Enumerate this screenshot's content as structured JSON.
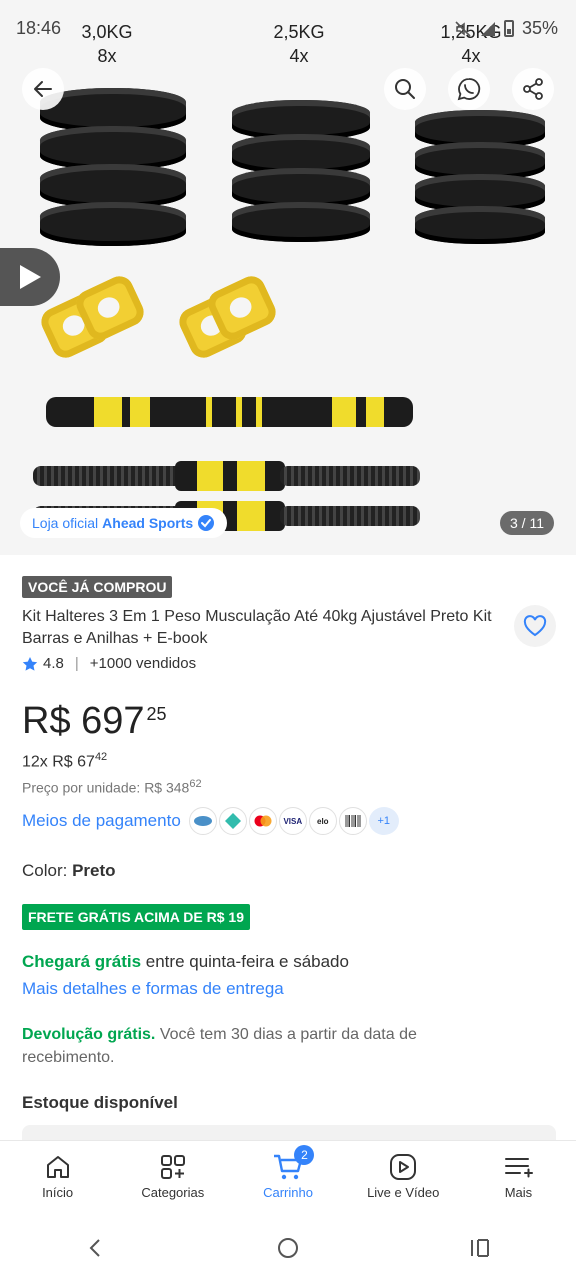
{
  "status_bar": {
    "time": "18:46",
    "battery": "35%"
  },
  "gallery": {
    "weights": [
      {
        "kg": "3,0KG",
        "qty": "8x"
      },
      {
        "kg": "2,5KG",
        "qty": "4x"
      },
      {
        "kg": "1,25KG",
        "qty": "4x"
      }
    ],
    "store_prefix": "Loja oficial",
    "store_name": "Ahead Sports",
    "counter": "3 / 11"
  },
  "product": {
    "badge": "VOCÊ JÁ COMPROU",
    "title": "Kit Halteres 3 Em 1 Peso Musculação Até 40kg Ajustável Preto Kit Barras e Anilhas + E-book",
    "rating": "4.8",
    "sold": "+1000 vendidos",
    "price_int": "R$ 697",
    "price_cents": "25",
    "installments_prefix": "12x R$ 67",
    "installments_cents": "42",
    "unit_price_prefix": "Preço por unidade: R$ 348",
    "unit_price_cents": "62",
    "payment_link": "Meios de pagamento",
    "payment_icons": [
      "hipercard",
      "pix",
      "mastercard",
      "VISA",
      "elo",
      "boleto"
    ],
    "payment_more": "+1",
    "color_label": "Color:",
    "color_value": "Preto",
    "shipping_badge": "FRETE GRÁTIS ACIMA DE R$ 19",
    "arrival_bold": "Chegará grátis",
    "arrival_rest": " entre quinta-feira e sábado",
    "shipping_link": "Mais detalhes e formas de entrega",
    "return_bold": "Devolução grátis.",
    "return_rest": " Você tem 30 dias a partir da data de recebimento.",
    "stock": "Estoque disponível"
  },
  "nav": {
    "items": [
      {
        "label": "Início",
        "icon": "home-icon"
      },
      {
        "label": "Categorias",
        "icon": "categories-icon"
      },
      {
        "label": "Carrinho",
        "icon": "cart-icon",
        "badge": "2"
      },
      {
        "label": "Live e Vídeo",
        "icon": "video-icon"
      },
      {
        "label": "Mais",
        "icon": "menu-icon"
      }
    ]
  },
  "colors": {
    "accent": "#3483fa",
    "green": "#00a650",
    "badge_gray": "#5b5b5b"
  }
}
